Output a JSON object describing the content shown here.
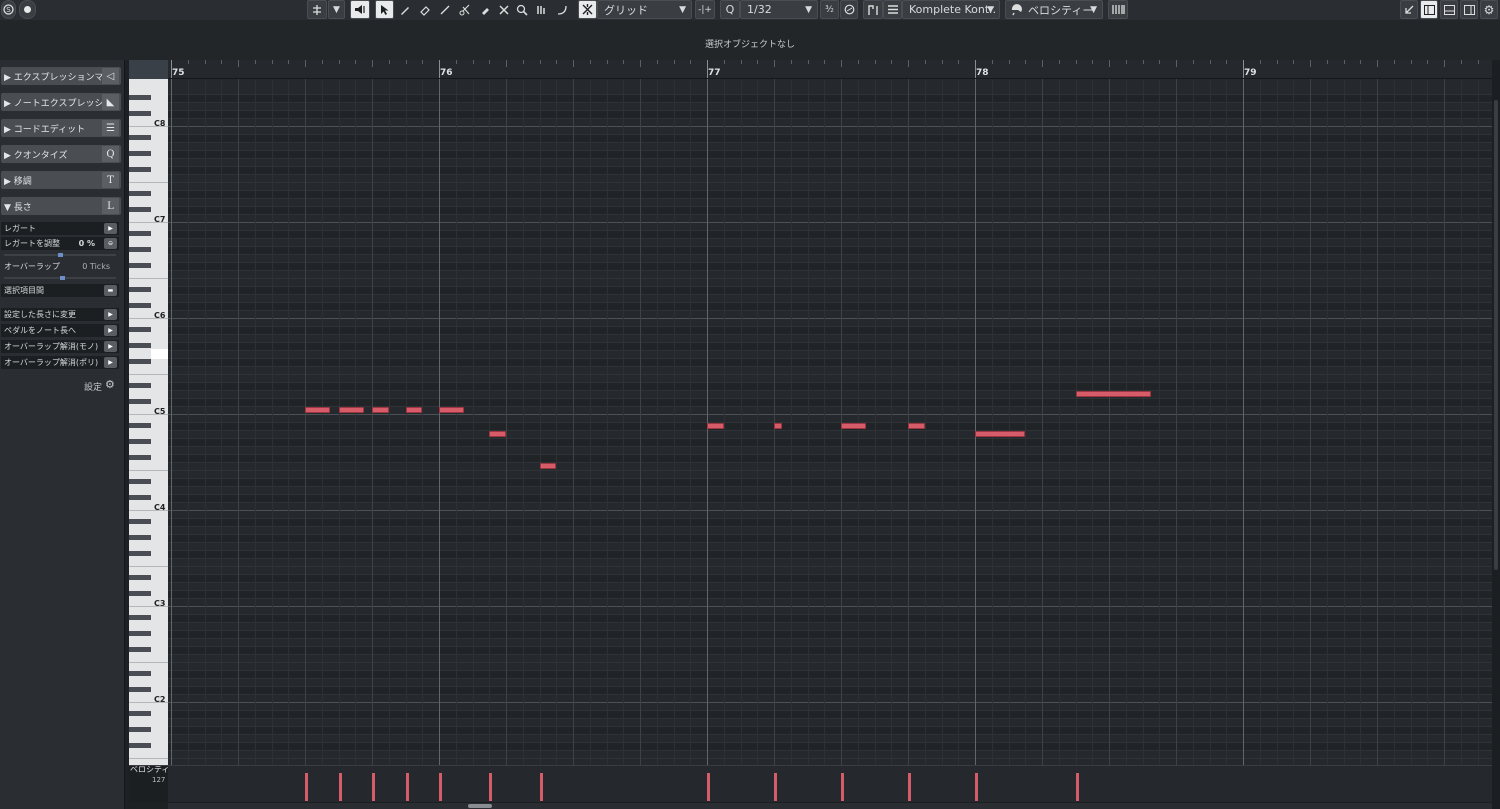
{
  "toolbar": {
    "snap_mode": "グリッド",
    "quantize": "1/32",
    "quantize_prefix": "Q",
    "triplet_label": "³⁄₂",
    "instrument": "Komplete Kontr.",
    "lane_type": "ベロシティー",
    "icons": [
      "automation-icon",
      "record-icon",
      "split-view-icon",
      "speaker-icon",
      "arrow-tool-icon",
      "pencil-tool-icon",
      "eraser-tool-icon",
      "line-tool-icon",
      "split-tool-icon",
      "glue-tool-icon",
      "mute-tool-icon",
      "zoom-tool-icon",
      "trim-tool-icon",
      "curve-tool-icon",
      "snap-icon",
      "grid-icon",
      "link-icon",
      "keyboard-icon",
      "layout-icons"
    ]
  },
  "status": {
    "text": "選択オブジェクトなし"
  },
  "inspector": {
    "sections": [
      {
        "label": "▶ エクスプレッションマ",
        "icon": "◁"
      },
      {
        "label": "▶ ノートエクスプレッシ",
        "icon": "◣"
      },
      {
        "label": "▶ コードエディット",
        "icon": "☰"
      },
      {
        "label": "▶ クオンタイズ",
        "icon": "Q"
      },
      {
        "label": "▶ 移調",
        "icon": "T"
      },
      {
        "label": "▼ 長さ",
        "icon": "L"
      }
    ],
    "legato_label": "レガート",
    "legato_adjust_label": "レガートを調整",
    "legato_adjust_value": "0 %",
    "overlap_label": "オーバーラップ",
    "overlap_value": "0 Ticks",
    "between_label": "選択項目間",
    "actions": [
      "設定した長さに変更",
      "ペダルをノート長へ",
      "オーバーラップ解消(モノ)",
      "オーバーラップ解消(ポリ)"
    ],
    "settings_label": "設定"
  },
  "ruler": {
    "bars": [
      "75",
      "76",
      "77",
      "78",
      "79"
    ]
  },
  "keyboard": {
    "octave_labels": [
      "C8",
      "C7",
      "C6",
      "C5",
      "C4",
      "C3",
      "C2"
    ]
  },
  "notes": [
    {
      "bar": 75.5,
      "len": 0.094,
      "pitch": "C5"
    },
    {
      "bar": 75.625,
      "len": 0.094,
      "pitch": "C5"
    },
    {
      "bar": 75.75,
      "len": 0.063,
      "pitch": "C5"
    },
    {
      "bar": 75.875,
      "len": 0.063,
      "pitch": "C5"
    },
    {
      "bar": 76.0,
      "len": 0.094,
      "pitch": "C5"
    },
    {
      "bar": 76.188,
      "len": 0.063,
      "pitch": "A4"
    },
    {
      "bar": 76.375,
      "len": 0.063,
      "pitch": "F4"
    },
    {
      "bar": 77.0,
      "len": 0.063,
      "pitch": "A#4"
    },
    {
      "bar": 77.25,
      "len": 0.031,
      "pitch": "A#4"
    },
    {
      "bar": 77.5,
      "len": 0.094,
      "pitch": "A#4"
    },
    {
      "bar": 77.75,
      "len": 0.063,
      "pitch": "A#4"
    },
    {
      "bar": 78.0,
      "len": 0.188,
      "pitch": "A4"
    },
    {
      "bar": 78.375,
      "len": 0.281,
      "pitch": "D5"
    }
  ],
  "velocity": {
    "label": "ベロシティ",
    "max_label": "127",
    "value": 127
  }
}
